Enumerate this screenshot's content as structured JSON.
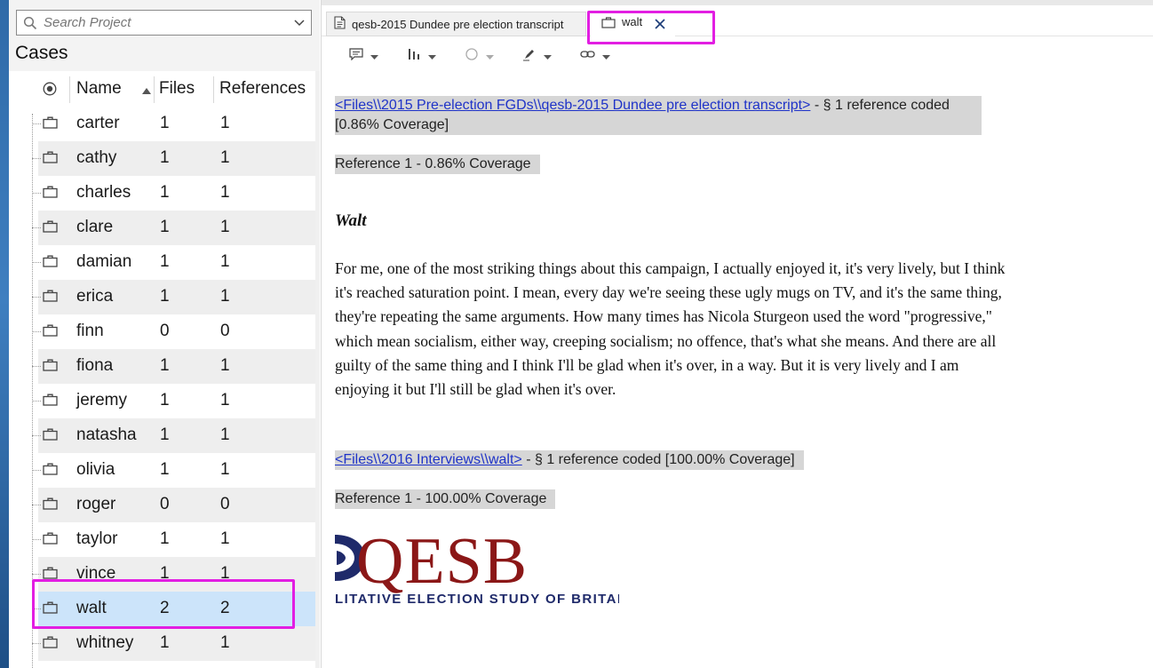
{
  "search": {
    "placeholder": "Search Project"
  },
  "cases_panel": {
    "title": "Cases",
    "columns": {
      "name": "Name",
      "files": "Files",
      "references": "References"
    },
    "rows": [
      {
        "name": "carter",
        "files": "1",
        "references": "1"
      },
      {
        "name": "cathy",
        "files": "1",
        "references": "1"
      },
      {
        "name": "charles",
        "files": "1",
        "references": "1"
      },
      {
        "name": "clare",
        "files": "1",
        "references": "1"
      },
      {
        "name": "damian",
        "files": "1",
        "references": "1"
      },
      {
        "name": "erica",
        "files": "1",
        "references": "1"
      },
      {
        "name": "finn",
        "files": "0",
        "references": "0"
      },
      {
        "name": "fiona",
        "files": "1",
        "references": "1"
      },
      {
        "name": "jeremy",
        "files": "1",
        "references": "1"
      },
      {
        "name": "natasha",
        "files": "1",
        "references": "1"
      },
      {
        "name": "olivia",
        "files": "1",
        "references": "1"
      },
      {
        "name": "roger",
        "files": "0",
        "references": "0"
      },
      {
        "name": "taylor",
        "files": "1",
        "references": "1"
      },
      {
        "name": "vince",
        "files": "1",
        "references": "1"
      },
      {
        "name": "walt",
        "files": "2",
        "references": "2"
      },
      {
        "name": "whitney",
        "files": "1",
        "references": "1"
      }
    ],
    "selected_row": "walt"
  },
  "tabs": [
    {
      "label": "qesb-2015 Dundee pre election transcript",
      "icon": "document-icon"
    },
    {
      "label": "walt",
      "icon": "case-icon",
      "active": true
    }
  ],
  "toolbar": {
    "items": [
      "annotation-icon",
      "coding-stripes-icon",
      "circle-icon",
      "highlight-pen-icon",
      "link-icon"
    ]
  },
  "document": {
    "ref1": {
      "link": "<Files\\\\2015 Pre-election FGDs\\\\qesb-2015 Dundee pre election transcript>",
      "summary": " - § 1 reference coded ",
      "coverage": "[0.86% Coverage]",
      "reference_line": "Reference 1 - 0.86% Coverage"
    },
    "speaker": "Walt",
    "paragraph": "For me, one of the most striking things about this campaign, I actually enjoyed it, it's very lively, but I think it's reached saturation point. I mean, every day we're seeing these ugly mugs on TV, and it's the same thing, they're repeating the same arguments. How many times has Nicola Sturgeon used the word \"progressive,\" which mean socialism, either way, creeping socialism; no offence, that's what she means. And there are all guilty of the same thing and I think I'll be glad when it's over, in a way. But it is very lively and I am enjoying it but I'll still be glad when it's over.",
    "ref2": {
      "link": "<Files\\\\2016 Interviews\\\\walt>",
      "summary": " - § 1 reference coded  [100.00% Coverage]",
      "reference_line": "Reference 1 - 100.00% Coverage"
    },
    "logo": {
      "word": "QESB",
      "subtitle": "LITATIVE ELECTION STUDY OF BRITAIN"
    }
  },
  "colors": {
    "highlight": "#e21ee2",
    "selected_row": "#cce4fa",
    "link": "#1f33c8",
    "logo_red": "#8b1717",
    "logo_navy": "#1f2a6a"
  }
}
